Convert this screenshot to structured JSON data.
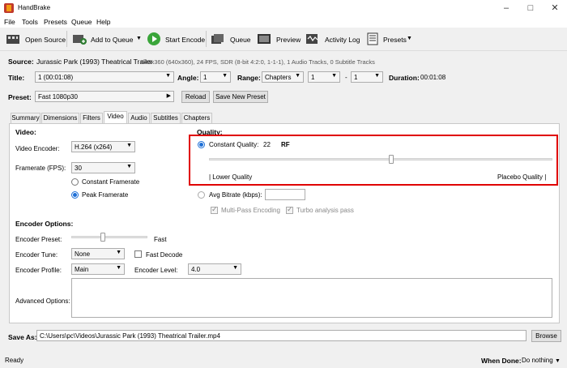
{
  "window": {
    "title": "HandBrake"
  },
  "menu": [
    "File",
    "Tools",
    "Presets",
    "Queue",
    "Help"
  ],
  "toolbar": {
    "open_source": "Open Source",
    "add_to_queue": "Add to Queue",
    "start_encode": "Start Encode",
    "queue": "Queue",
    "preview": "Preview",
    "activity_log": "Activity Log",
    "presets": "Presets"
  },
  "source": {
    "label": "Source:",
    "name": "Jurassic Park (1993) Theatrical Trailer",
    "info": "640x360 (640x360), 24 FPS, SDR (8-bit 4:2:0, 1-1-1), 1 Audio Tracks, 0 Subtitle Tracks"
  },
  "title_row": {
    "title_label": "Title:",
    "title_value": "1 (00:01:08)",
    "angle_label": "Angle:",
    "angle_value": "1",
    "range_label": "Range:",
    "range_value": "Chapters",
    "range_from": "1",
    "range_sep": "-",
    "range_to": "1",
    "duration_label": "Duration:",
    "duration_value": "00:01:08"
  },
  "preset_row": {
    "label": "Preset:",
    "value": "Fast 1080p30",
    "reload": "Reload",
    "save_new": "Save New Preset"
  },
  "tabs": [
    "Summary",
    "Dimensions",
    "Filters",
    "Video",
    "Audio",
    "Subtitles",
    "Chapters"
  ],
  "video": {
    "header": "Video:",
    "encoder_label": "Video Encoder:",
    "encoder_value": "H.264 (x264)",
    "framerate_label": "Framerate (FPS):",
    "framerate_value": "30",
    "constant_framerate": "Constant Framerate",
    "peak_framerate": "Peak Framerate"
  },
  "quality": {
    "header": "Quality:",
    "constant_label": "Constant Quality:",
    "constant_value": "22",
    "rf": "RF",
    "slider_fraction": 0.53,
    "lower": "| Lower Quality",
    "placebo": "Placebo Quality |",
    "avg_bitrate_label": "Avg Bitrate (kbps):",
    "multipass": "Multi-Pass Encoding",
    "turbo": "Turbo analysis pass"
  },
  "encoder_options": {
    "header": "Encoder Options:",
    "preset_label": "Encoder Preset:",
    "preset_value": "Fast",
    "preset_slider_fraction": 0.42,
    "tune_label": "Encoder Tune:",
    "tune_value": "None",
    "fast_decode": "Fast Decode",
    "profile_label": "Encoder Profile:",
    "profile_value": "Main",
    "level_label": "Encoder Level:",
    "level_value": "4.0",
    "advanced_label": "Advanced Options:"
  },
  "save_as": {
    "label": "Save As:",
    "path": "C:\\Users\\pc\\Videos\\Jurassic Park (1993) Theatrical Trailer.mp4",
    "browse": "Browse"
  },
  "status": {
    "text": "Ready",
    "when_done_label": "When Done:",
    "when_done_value": "Do nothing"
  },
  "colors": {
    "accent": "#1e6fd6",
    "highlight": "#e00000",
    "start_green": "#3aa53a"
  }
}
